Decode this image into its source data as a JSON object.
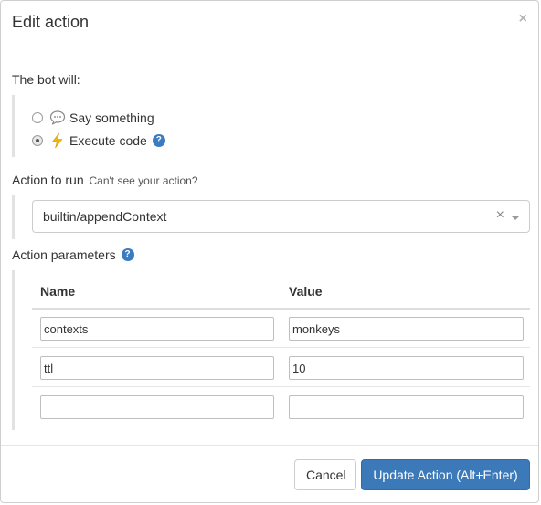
{
  "modal": {
    "title": "Edit action",
    "close_symbol": "×"
  },
  "bot_will": {
    "label": "The bot will:",
    "options": [
      {
        "label": "Say something",
        "icon": "speech-bubble-icon",
        "selected": false
      },
      {
        "label": "Execute code",
        "icon": "lightning-bolt-icon",
        "selected": true
      }
    ],
    "help_symbol": "?"
  },
  "action_to_run": {
    "label": "Action to run",
    "hint": "Can't see your action?",
    "selected_value": "builtin/appendContext",
    "clear_symbol": "×"
  },
  "action_parameters": {
    "label": "Action parameters",
    "help_symbol": "?",
    "columns": [
      "Name",
      "Value"
    ],
    "rows": [
      {
        "name": "contexts",
        "value": "monkeys"
      },
      {
        "name": "ttl",
        "value": "10"
      },
      {
        "name": "",
        "value": ""
      }
    ]
  },
  "footer": {
    "cancel_label": "Cancel",
    "submit_label": "Update Action (Alt+Enter)"
  },
  "colors": {
    "primary_button": "#3b79b8",
    "help_icon": "#3b7bbf",
    "bolt": "#f2b705"
  }
}
